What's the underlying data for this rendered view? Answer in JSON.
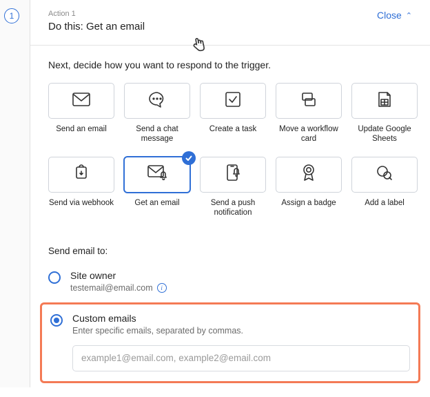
{
  "step_number": "1",
  "header": {
    "action_label": "Action 1",
    "title": "Do this: Get an email",
    "close": "Close"
  },
  "prompt": "Next, decide how you want to respond to the trigger.",
  "tiles": [
    {
      "id": "send-email",
      "label": "Send an email",
      "icon": "mail"
    },
    {
      "id": "send-chat",
      "label": "Send a chat message",
      "icon": "chat"
    },
    {
      "id": "create-task",
      "label": "Create a task",
      "icon": "check"
    },
    {
      "id": "move-card",
      "label": "Move a workflow card",
      "icon": "cards"
    },
    {
      "id": "update-sheets",
      "label": "Update Google Sheets",
      "icon": "sheets"
    },
    {
      "id": "send-webhook",
      "label": "Send via webhook",
      "icon": "webhook"
    },
    {
      "id": "get-email",
      "label": "Get an email",
      "icon": "mail-bell",
      "selected": true
    },
    {
      "id": "push-notif",
      "label": "Send a push notification",
      "icon": "phone-bell"
    },
    {
      "id": "assign-badge",
      "label": "Assign a badge",
      "icon": "badge"
    },
    {
      "id": "add-label",
      "label": "Add a label",
      "icon": "label"
    }
  ],
  "send_to": {
    "heading": "Send email to:",
    "options": [
      {
        "id": "site-owner",
        "title": "Site owner",
        "sub": "testemail@email.com",
        "info": true,
        "selected": false
      },
      {
        "id": "custom-emails",
        "title": "Custom emails",
        "sub": "Enter specific emails, separated by commas.",
        "info": false,
        "selected": true
      }
    ],
    "input_placeholder": "example1@email.com, example2@email.com",
    "input_value": ""
  }
}
